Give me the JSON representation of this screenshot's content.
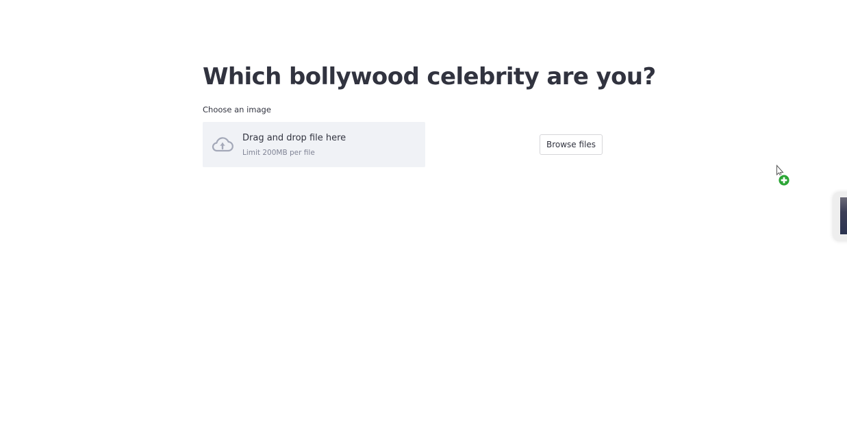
{
  "page": {
    "title": "Which bollywood celebrity are you?"
  },
  "uploader": {
    "label": "Choose an image",
    "drop_text": "Drag and drop file here",
    "limit_text": "Limit 200MB per file",
    "browse_label": "Browse files",
    "icon": "cloud-upload-icon"
  },
  "drag_overlay": {
    "cursor_icon": "copy-cursor-icon",
    "thumbnail": "dragged-image-thumbnail"
  },
  "colors": {
    "text": "#31333f",
    "dropzone_bg": "#f0f2f6",
    "muted": "#808495",
    "icon": "#a3a8b8",
    "plus_badge": "#2aa534"
  }
}
